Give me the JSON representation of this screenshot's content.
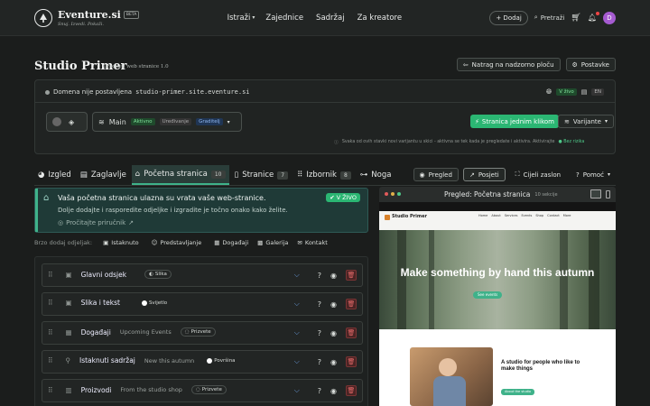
{
  "brand": {
    "name": "Eventure.si",
    "tagline": "Snuj. Izvedi. Pokaži.",
    "beta": "BETA"
  },
  "nav": {
    "links": [
      "Istraži",
      "Zajednice",
      "Sadržaj",
      "Za kreatore"
    ],
    "add": "+ Dodaj",
    "search": "Pretraži",
    "avatar": "D"
  },
  "page": {
    "title": "Studio Primer",
    "subtitle": "Graditelj web stranice 1.0",
    "back": "Natrag na nadzorno ploču",
    "settings": "Postavke"
  },
  "domain": {
    "status": "Domena nije postavljena",
    "address": "studio-primer.site.eventure.si",
    "live": "V živo",
    "lang": "EN",
    "main": "Main",
    "active": "Aktivno",
    "editing": "Uređivanje",
    "builder": "Graditelj",
    "cta": "Stranica jednim klikom",
    "variants": "Varijante",
    "note": "Svaka od ovih stavki novi varijantu u skici - aktivna se tek kada je pregledate i aktivira. Aktivirajte",
    "note_link": "Bez rizika"
  },
  "tabs": [
    {
      "label": "Izgled",
      "count": ""
    },
    {
      "label": "Zaglavlje",
      "count": ""
    },
    {
      "label": "Početna stranica",
      "count": "10"
    },
    {
      "label": "Stranice",
      "count": "7"
    },
    {
      "label": "Izbornik",
      "count": "8"
    },
    {
      "label": "Noga",
      "count": ""
    }
  ],
  "view": {
    "preview": "Pregled",
    "visit": "Posjeti",
    "fullscreen": "Cijeli zaslon",
    "help": "Pomoć"
  },
  "notice": {
    "title": "Vaša početna stranica ulazna su vrata vaše web-stranice.",
    "body": "Dolje dodajte i rasporedite odjeljke i izgradite je točno onako kako želite.",
    "link": "Pročitajte priručnik",
    "badge": "V ŽIVO"
  },
  "quick": {
    "label": "Brzo dodaj odjeljak:",
    "items": [
      "Istaknuto",
      "Predstavljanje",
      "Događaji",
      "Galerija",
      "Kontakt"
    ]
  },
  "sections": [
    {
      "name": "Glavni odsjek",
      "desc": "",
      "badge": "Slika"
    },
    {
      "name": "Slika i tekst",
      "desc": "",
      "badge": "Svijetlo"
    },
    {
      "name": "Događaji",
      "desc": "Upcoming Events",
      "badge": "Prizvete"
    },
    {
      "name": "Istaknuti sadržaj",
      "desc": "New this autumn",
      "badge": "Površina"
    },
    {
      "name": "Proizvodi",
      "desc": "From the studio shop",
      "badge": "Prizvete"
    }
  ],
  "preview": {
    "title": "Pregled: Početna stranica",
    "count": "10 sekcije",
    "site_name": "Studio Primer",
    "hero": "Make something by hand this autumn",
    "hero_btn": "See events",
    "feature_title": "A studio for people who like to make things",
    "feature_btn": "About the studio",
    "menu": [
      "Home",
      "About",
      "Services",
      "Events",
      "Shop",
      "Contact",
      "More"
    ]
  }
}
